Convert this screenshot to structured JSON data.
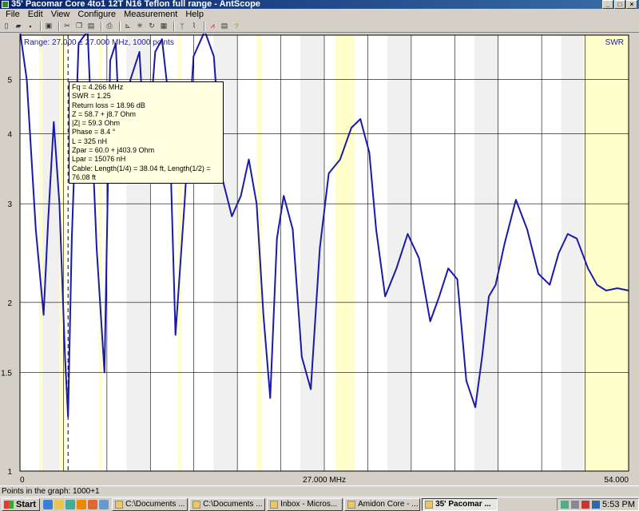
{
  "window": {
    "title": "35' Pacomar Core 4to1 12T N16 Teflon full range - AntScope",
    "buttons": [
      "_",
      "□",
      "×"
    ]
  },
  "menu": [
    "File",
    "Edit",
    "View",
    "Configure",
    "Measurement",
    "Help"
  ],
  "toolbar": {
    "icons": [
      "new-icon",
      "open-icon",
      "save-icon",
      "screen-icon",
      "cut-icon",
      "copy-icon",
      "paste-icon",
      "print-icon",
      "marker-icon",
      "zoom-icon",
      "refresh-icon",
      "scan-icon",
      "antenna-icon",
      "signal-icon",
      "limits-icon",
      "table-icon",
      "help-icon"
    ]
  },
  "plot": {
    "range_text": "Range: 27.000 ± 27.000 MHz, 1000 points",
    "mode_label": "SWR",
    "colors": {
      "background": "#ffffff",
      "band": "#f0f0f0",
      "ham_band": "#ffffcc",
      "trace": "#1a1aa8",
      "grid": "#000000"
    }
  },
  "chart_data": {
    "type": "line",
    "xlabel": "",
    "ylabel": "",
    "x_ticks": [
      "0",
      "27.000 MHz",
      "54.000"
    ],
    "xlim": [
      0,
      54
    ],
    "y_ticks": [
      "1",
      "1.5",
      "2",
      "3",
      "4",
      "5"
    ],
    "ylim": [
      1,
      6
    ],
    "series": [
      {
        "x": [
          0,
          0.6,
          1.4,
          2.1,
          2.5,
          3.0,
          3.5,
          4.0,
          4.266,
          4.6,
          5.2,
          6.0,
          6.8,
          7.5,
          8.0,
          8.5,
          9.0,
          9.8,
          10.6,
          11.2,
          12.0,
          12.6,
          13.2,
          13.8,
          14.6,
          15.4,
          16.4,
          17.2,
          18.0,
          18.8,
          19.6,
          20.3,
          21.0,
          21.6,
          22.2,
          22.8,
          23.4,
          24.2,
          25.0,
          25.8,
          26.6,
          27.4,
          28.4,
          29.4,
          30.2,
          31.0,
          31.6,
          32.4,
          33.4,
          34.4,
          35.4,
          36.4,
          37.2,
          38.0,
          38.8,
          39.6,
          40.4,
          41.0,
          41.6,
          42.2,
          43.0,
          44.0,
          45.0,
          46.0,
          47.0,
          47.8,
          48.6,
          49.4,
          50.4,
          51.2,
          52.0,
          53.0,
          54.0
        ],
        "y": [
          6.1,
          5.0,
          2.7,
          1.9,
          2.8,
          4.2,
          3.0,
          1.6,
          1.25,
          2.6,
          5.8,
          6.1,
          2.5,
          1.5,
          5.4,
          5.8,
          3.4,
          5.0,
          5.6,
          3.4,
          5.6,
          5.9,
          4.6,
          1.75,
          3.0,
          5.5,
          6.1,
          5.5,
          3.3,
          2.85,
          3.1,
          3.6,
          3.0,
          1.9,
          1.35,
          2.6,
          3.1,
          2.7,
          1.6,
          1.4,
          2.5,
          3.4,
          3.6,
          4.1,
          4.25,
          3.7,
          2.7,
          2.05,
          2.3,
          2.65,
          2.4,
          1.85,
          2.05,
          2.3,
          2.2,
          1.45,
          1.3,
          1.6,
          2.05,
          2.15,
          2.55,
          3.05,
          2.7,
          2.25,
          2.15,
          2.45,
          2.65,
          2.6,
          2.3,
          2.15,
          2.1,
          2.12,
          2.1
        ]
      }
    ]
  },
  "marker": {
    "lines": [
      "Fq = 4.266 MHz",
      "SWR = 1.25",
      "Return loss = 18.96 dB",
      "Z = 58.7 + j8.7 Ohm",
      "|Z| = 59.3 Ohm",
      "Phase = 8.4 °",
      "L = 325 nH",
      "Zpar = 60.0 + j403.9 Ohm",
      "Lpar = 15076 nH",
      "Cable: Length(1/4) = 38.04 ft, Length(1/2) = 76.08 ft"
    ]
  },
  "status": {
    "text": "Points in the graph: 1000+1"
  },
  "taskbar": {
    "start": "Start",
    "tasks": [
      "C:\\Documents ...",
      "C:\\Documents ...",
      "Inbox - Micros...",
      "Amidon Core - ...",
      "35' Pacomar ..."
    ],
    "active_index": 4,
    "clock": "5:53 PM"
  }
}
